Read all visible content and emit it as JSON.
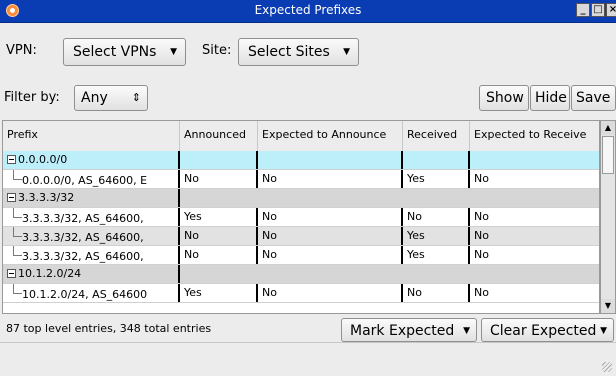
{
  "window": {
    "title": "Expected Prefixes",
    "controls": [
      "minimize",
      "maximize",
      "close"
    ]
  },
  "toolbar": {
    "vpn_label": "VPN:",
    "vpn_select": "Select VPNs",
    "site_label": "Site:",
    "site_select": "Select Sites"
  },
  "filter": {
    "label": "Filter by:",
    "value": "Any"
  },
  "actions": {
    "show": "Show",
    "hide": "Hide",
    "save": "Save"
  },
  "table": {
    "columns": [
      "Prefix",
      "Announced",
      "Expected to Announce",
      "Received",
      "Expected to Receive"
    ],
    "rows": [
      {
        "prefix": "0.0.0.0/0",
        "announced": "",
        "expected_announce": "",
        "received": "",
        "expected_receive": ""
      },
      {
        "prefix": "0.0.0.0/0, AS_64600, E",
        "announced": "No",
        "expected_announce": "No",
        "received": "Yes",
        "expected_receive": "No"
      },
      {
        "prefix": "3.3.3.3/32",
        "announced": "",
        "expected_announce": "",
        "received": "",
        "expected_receive": ""
      },
      {
        "prefix": "3.3.3.3/32, AS_64600,",
        "announced": "Yes",
        "expected_announce": "No",
        "received": "No",
        "expected_receive": "No"
      },
      {
        "prefix": "3.3.3.3/32, AS_64600,",
        "announced": "No",
        "expected_announce": "No",
        "received": "Yes",
        "expected_receive": "No"
      },
      {
        "prefix": "3.3.3.3/32, AS_64600,",
        "announced": "No",
        "expected_announce": "No",
        "received": "Yes",
        "expected_receive": "No"
      },
      {
        "prefix": "10.1.2.0/24",
        "announced": "",
        "expected_announce": "",
        "received": "",
        "expected_receive": ""
      },
      {
        "prefix": "10.1.2.0/24, AS_64600",
        "announced": "Yes",
        "expected_announce": "No",
        "received": "No",
        "expected_receive": "No"
      }
    ]
  },
  "status": {
    "text": "87 top level entries, 348 total entries"
  },
  "bottom_actions": {
    "mark_expected": "Mark Expected",
    "clear_expected": "Clear Expected"
  }
}
